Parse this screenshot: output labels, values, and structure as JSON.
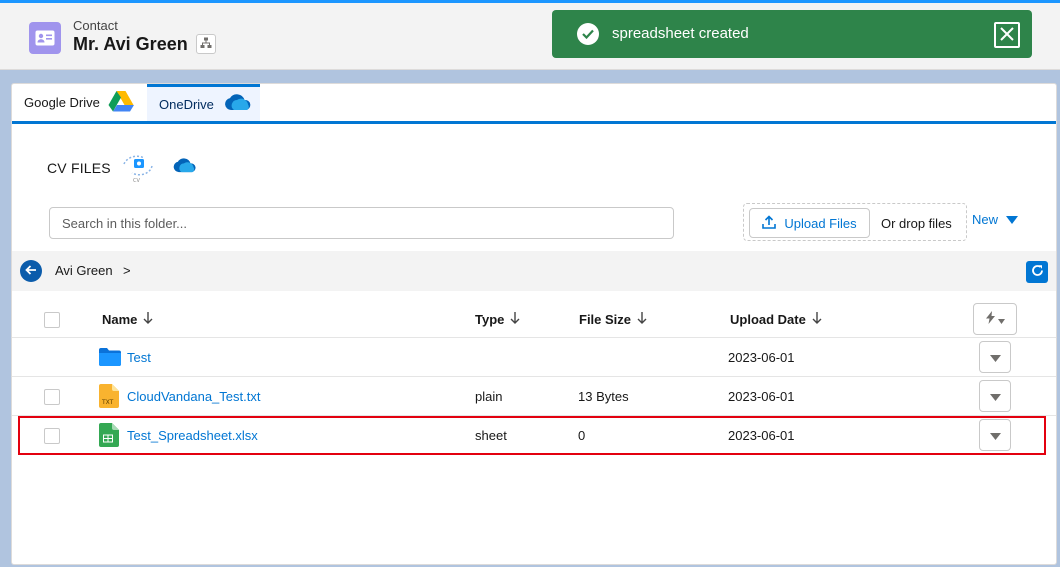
{
  "header": {
    "record_type": "Contact",
    "record_name": "Mr. Avi Green"
  },
  "toast": {
    "message": "spreadsheet created",
    "color": "#2e844a"
  },
  "tabs": [
    {
      "label": "Google Drive",
      "icon": "google-drive-icon",
      "active": false
    },
    {
      "label": "OneDrive",
      "icon": "onedrive-icon",
      "active": true
    }
  ],
  "section": {
    "title": "CV FILES"
  },
  "search": {
    "placeholder": "Search in this folder...",
    "value": ""
  },
  "upload": {
    "button_label": "Upload Files",
    "drop_label": "Or drop files",
    "new_label": "New"
  },
  "breadcrumb": {
    "current": "Avi Green",
    "separator": ">"
  },
  "table": {
    "columns": [
      "Name",
      "Type",
      "File Size",
      "Upload Date"
    ],
    "rows": [
      {
        "name": "Test",
        "kind": "folder",
        "type": "",
        "size": "",
        "date": "2023-06-01"
      },
      {
        "name": "CloudVandana_Test.txt",
        "kind": "txt",
        "type": "plain",
        "size": "13 Bytes",
        "date": "2023-06-01"
      },
      {
        "name": "Test_Spreadsheet.xlsx",
        "kind": "sheet",
        "type": "sheet",
        "size": "0",
        "date": "2023-06-01",
        "highlighted": true
      }
    ]
  },
  "colors": {
    "brand_blue": "#0176d3",
    "highlight_red": "#e3000f",
    "contact_icon": "#a094ed"
  }
}
